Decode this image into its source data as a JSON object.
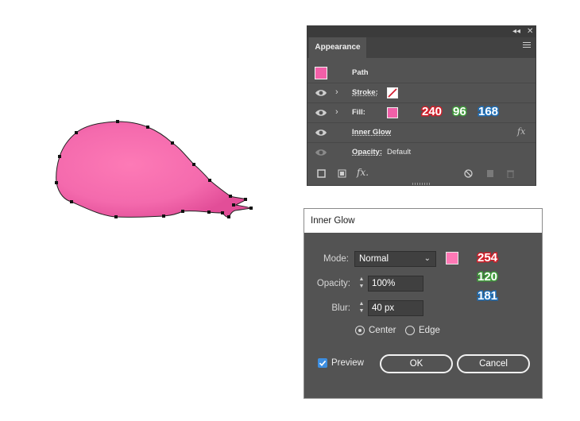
{
  "appearance_panel": {
    "tab_label": "Appearance",
    "topbar": {
      "collapse_glyph": "◂◂",
      "close_glyph": "✕"
    },
    "rows": {
      "path": {
        "label": "Path",
        "swatch_color": "#f25fa8"
      },
      "stroke": {
        "label": "Stroke:",
        "swatch": "none"
      },
      "fill": {
        "label": "Fill:",
        "swatch_color": "#f060a8",
        "rgb": {
          "r": "240",
          "g": "96",
          "b": "168"
        }
      },
      "inner_glow": {
        "label": "Inner Glow",
        "fx_label": "fx"
      },
      "opacity": {
        "label": "Opacity:",
        "value": "Default"
      }
    },
    "bottom_icons": [
      "new-stroke-icon",
      "new-fill-icon",
      "fx-icon",
      "clear-icon",
      "duplicate-icon",
      "delete-icon"
    ],
    "fx_bottom_label": "fx."
  },
  "inner_glow_dialog": {
    "title": "Inner Glow",
    "mode": {
      "label": "Mode:",
      "value": "Normal",
      "color": "#fe78b5",
      "rgb": {
        "r": "254",
        "g": "120",
        "b": "181"
      }
    },
    "opacity": {
      "label": "Opacity:",
      "value": "100%"
    },
    "blur": {
      "label": "Blur:",
      "value": "40 px"
    },
    "source": {
      "options": [
        "Center",
        "Edge"
      ],
      "selected": "Center"
    },
    "preview": {
      "label": "Preview",
      "checked": true
    },
    "ok_label": "OK",
    "cancel_label": "Cancel"
  },
  "canvas": {
    "shape_color": "#f870b4"
  }
}
